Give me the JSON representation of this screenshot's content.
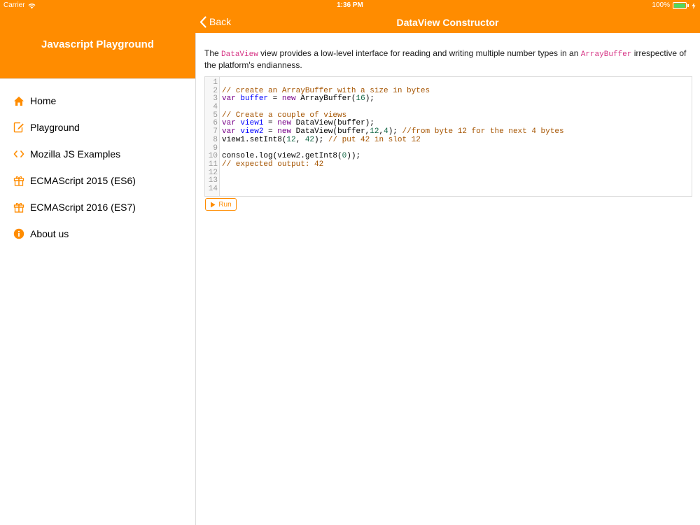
{
  "status_bar": {
    "carrier": "Carrier",
    "time": "1:36 PM",
    "battery": "100%"
  },
  "sidebar": {
    "app_title": "Javascript Playground",
    "items": [
      {
        "label": "Home",
        "icon": "home-icon"
      },
      {
        "label": "Playground",
        "icon": "edit-icon"
      },
      {
        "label": "Mozilla JS Examples",
        "icon": "code-icon"
      },
      {
        "label": "ECMAScript 2015 (ES6)",
        "icon": "gift-icon"
      },
      {
        "label": "ECMAScript 2016 (ES7)",
        "icon": "gift-icon"
      },
      {
        "label": "About us",
        "icon": "info-icon"
      }
    ]
  },
  "navbar": {
    "back_label": "Back",
    "title": "DataView Constructor"
  },
  "description": {
    "part1": "The ",
    "code1": "DataView",
    "part2": " view provides a low-level interface for reading and writing multiple number types in an ",
    "code2": "ArrayBuffer",
    "part3": " irrespective of the platform's endianness."
  },
  "editor": {
    "line_numbers": [
      "1",
      "2",
      "3",
      "4",
      "5",
      "6",
      "7",
      "8",
      "9",
      "10",
      "11",
      "12",
      "13",
      "14"
    ]
  },
  "run_label": "Run",
  "colors": {
    "accent": "#ff8c00"
  }
}
